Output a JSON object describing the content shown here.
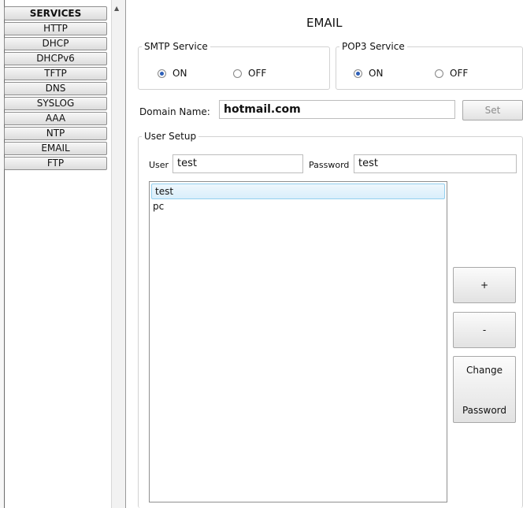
{
  "sidebar": {
    "header": "SERVICES",
    "items": [
      {
        "label": "HTTP"
      },
      {
        "label": "DHCP"
      },
      {
        "label": "DHCPv6"
      },
      {
        "label": "TFTP"
      },
      {
        "label": "DNS"
      },
      {
        "label": "SYSLOG"
      },
      {
        "label": "AAA"
      },
      {
        "label": "NTP"
      },
      {
        "label": "EMAIL"
      },
      {
        "label": "FTP"
      }
    ]
  },
  "main": {
    "title": "EMAIL",
    "smtp": {
      "legend": "SMTP Service",
      "on_label": "ON",
      "off_label": "OFF",
      "selected": "ON"
    },
    "pop3": {
      "legend": "POP3 Service",
      "on_label": "ON",
      "off_label": "OFF",
      "selected": "ON"
    },
    "domain": {
      "label": "Domain Name:",
      "value": "hotmail.com",
      "set_label": "Set"
    },
    "user_setup": {
      "legend": "User Setup",
      "user_label": "User",
      "user_value": "test",
      "password_label": "Password",
      "password_value": "test",
      "users": [
        {
          "name": "test",
          "selected": true
        },
        {
          "name": "pc",
          "selected": false
        }
      ],
      "add_label": "+",
      "remove_label": "-",
      "change_label_1": "Change",
      "change_label_2": "Password"
    }
  }
}
